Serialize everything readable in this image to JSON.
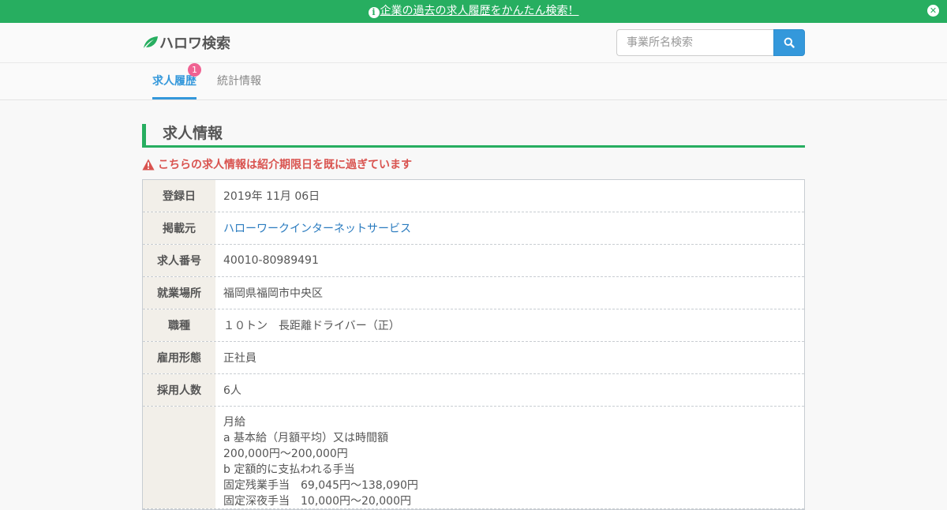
{
  "announcement": {
    "text": "企業の過去の求人履歴をかんたん検索！",
    "icon": "info-circle-icon",
    "close_icon": "times-circle-icon"
  },
  "header": {
    "logo_text": "ハロワ検索",
    "search_placeholder": "事業所名検索",
    "search_icon": "search-icon"
  },
  "tabs": [
    {
      "label": "求人履歴",
      "badge": "1",
      "active": true
    },
    {
      "label": "統計情報",
      "active": false
    }
  ],
  "section": {
    "title": "求人情報",
    "warning": "こちらの求人情報は紹介期限日を既に過ぎています"
  },
  "details": [
    {
      "label": "登録日",
      "value": "2019年 11月 06日"
    },
    {
      "label": "掲載元",
      "value": "ハローワークインターネットサービス"
    },
    {
      "label": "求人番号",
      "value": "40010-80989491"
    },
    {
      "label": "就業場所",
      "value": "福岡県福岡市中央区"
    },
    {
      "label": "職種",
      "value": "１０トン　長距離ドライバー（正）"
    },
    {
      "label": "雇用形態",
      "value": "正社員"
    },
    {
      "label": "採用人数",
      "value": "6人"
    }
  ],
  "salary": {
    "label": "",
    "lines": [
      "月給",
      "a 基本給（月額平均）又は時間額",
      "200,000円～200,000円",
      "b 定額的に支払われる手当",
      "固定残業手当　69,045円～138,090円",
      "固定深夜手当　10,000円～20,000円"
    ]
  },
  "colors": {
    "green": "#27ae60",
    "blue": "#3498db",
    "badge_pink": "#f06292",
    "warning_red": "#d9534f",
    "label_bg": "#f2efe9"
  }
}
